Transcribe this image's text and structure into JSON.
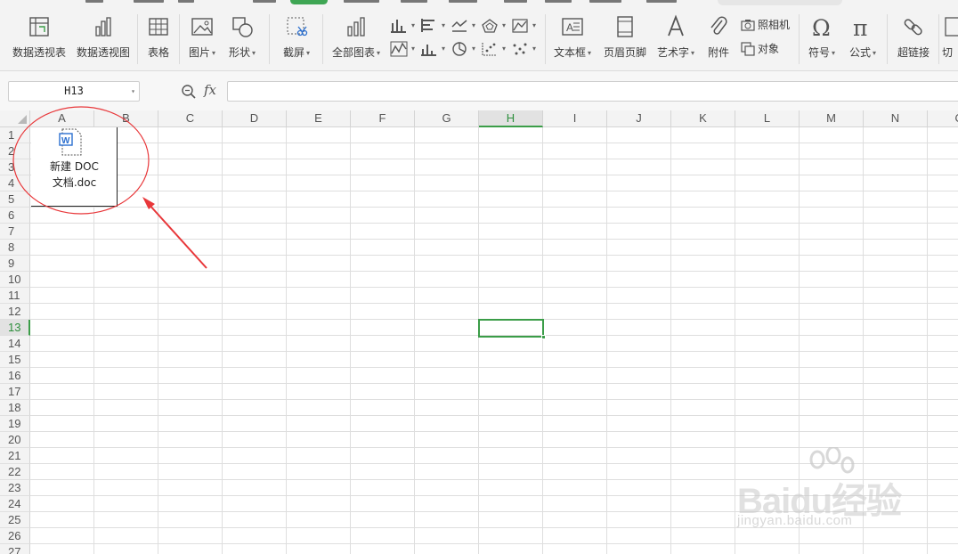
{
  "ribbon": {
    "buttons": [
      {
        "label": "数据透视表",
        "icon": "pivot-table-icon"
      },
      {
        "label": "数据透视图",
        "icon": "pivot-chart-icon"
      },
      {
        "label": "表格",
        "icon": "table-icon"
      },
      {
        "label": "图片",
        "icon": "picture-icon",
        "dropdown": true
      },
      {
        "label": "形状",
        "icon": "shape-icon",
        "dropdown": true
      },
      {
        "label": "截屏",
        "icon": "screenshot-icon",
        "dropdown": true
      },
      {
        "label": "全部图表",
        "icon": "all-charts-icon",
        "dropdown": true
      },
      {
        "label": "文本框",
        "icon": "textbox-icon",
        "dropdown": true
      },
      {
        "label": "页眉页脚",
        "icon": "header-footer-icon"
      },
      {
        "label": "艺术字",
        "icon": "wordart-icon",
        "dropdown": true
      },
      {
        "label": "附件",
        "icon": "attachment-icon"
      },
      {
        "label": "符号",
        "icon": "symbol-icon",
        "dropdown": true
      },
      {
        "label": "公式",
        "icon": "formula-icon",
        "dropdown": true
      },
      {
        "label": "超链接",
        "icon": "hyperlink-icon"
      },
      {
        "label": "切",
        "icon": "slicer-icon"
      }
    ],
    "camera_label": "照相机",
    "object_label": "对象"
  },
  "formula_bar": {
    "name_box": "H13",
    "fx_label": "fx",
    "formula": ""
  },
  "sheet": {
    "columns": [
      "A",
      "B",
      "C",
      "D",
      "E",
      "F",
      "G",
      "H",
      "I",
      "J",
      "K",
      "L",
      "M",
      "N",
      "O"
    ],
    "rows": [
      "1",
      "2",
      "3",
      "4",
      "5",
      "6",
      "7",
      "8",
      "9",
      "10",
      "11",
      "12",
      "13",
      "14",
      "15",
      "16",
      "17",
      "18",
      "19",
      "20",
      "21",
      "22",
      "23",
      "24",
      "25",
      "26",
      "27"
    ],
    "active_cell": "H13",
    "active_column": "H",
    "active_row": "13"
  },
  "embedded_object": {
    "line1": "新建 DOC",
    "line2": "文档.doc",
    "icon": "word-document-icon"
  },
  "watermark": {
    "logo": "Baidu经验",
    "url": "jingyan.baidu.com"
  },
  "colors": {
    "accent": "#3b9d48",
    "annotation": "#e8373a",
    "word_blue": "#2b6fcf"
  }
}
